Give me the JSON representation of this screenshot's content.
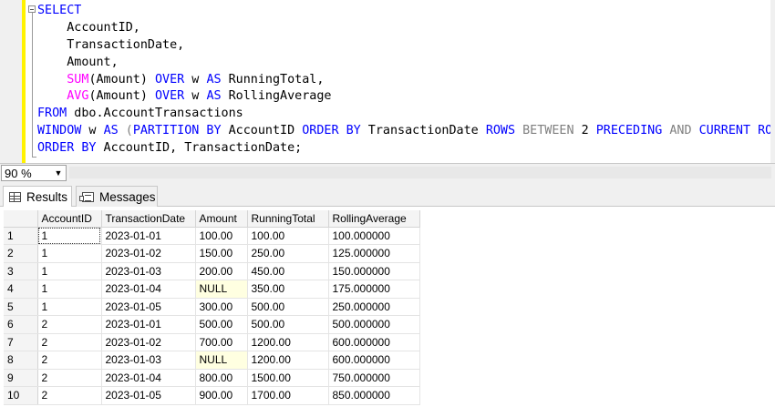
{
  "editor": {
    "code_lines": [
      [
        {
          "t": "SELECT",
          "c": "kw"
        }
      ],
      [
        {
          "t": "    AccountID,",
          "c": "id"
        }
      ],
      [
        {
          "t": "    TransactionDate,",
          "c": "id"
        }
      ],
      [
        {
          "t": "    Amount,",
          "c": "id"
        }
      ],
      [
        {
          "t": "    ",
          "c": "id"
        },
        {
          "t": "SUM",
          "c": "fn"
        },
        {
          "t": "(Amount) ",
          "c": "id"
        },
        {
          "t": "OVER",
          "c": "kw"
        },
        {
          "t": " w ",
          "c": "id"
        },
        {
          "t": "AS",
          "c": "kw"
        },
        {
          "t": " RunningTotal,",
          "c": "id"
        }
      ],
      [
        {
          "t": "    ",
          "c": "id"
        },
        {
          "t": "AVG",
          "c": "fn"
        },
        {
          "t": "(Amount) ",
          "c": "id"
        },
        {
          "t": "OVER",
          "c": "kw"
        },
        {
          "t": " w ",
          "c": "id"
        },
        {
          "t": "AS",
          "c": "kw"
        },
        {
          "t": " RollingAverage",
          "c": "id"
        }
      ],
      [
        {
          "t": "FROM",
          "c": "kw"
        },
        {
          "t": " dbo.AccountTransactions",
          "c": "id"
        }
      ],
      [
        {
          "t": "WINDOW",
          "c": "kw"
        },
        {
          "t": " w ",
          "c": "id"
        },
        {
          "t": "AS",
          "c": "kw"
        },
        {
          "t": " (",
          "c": "op"
        },
        {
          "t": "PARTITION BY",
          "c": "kw"
        },
        {
          "t": " AccountID ",
          "c": "id"
        },
        {
          "t": "ORDER BY",
          "c": "kw"
        },
        {
          "t": " TransactionDate ",
          "c": "id"
        },
        {
          "t": "ROWS",
          "c": "kw"
        },
        {
          "t": " BETWEEN ",
          "c": "op"
        },
        {
          "t": "2 ",
          "c": "id"
        },
        {
          "t": "PRECEDING",
          "c": "kw"
        },
        {
          "t": " AND ",
          "c": "op"
        },
        {
          "t": "CURRENT ROW",
          "c": "kw"
        },
        {
          "t": ")",
          "c": "op"
        }
      ],
      [
        {
          "t": "ORDER BY",
          "c": "kw"
        },
        {
          "t": " AccountID, TransactionDate;",
          "c": "id"
        }
      ]
    ]
  },
  "zoom": {
    "value": "90 %"
  },
  "tabs": {
    "results_label": "Results",
    "messages_label": "Messages"
  },
  "grid": {
    "columns": [
      "AccountID",
      "TransactionDate",
      "Amount",
      "RunningTotal",
      "RollingAverage"
    ],
    "rows": [
      {
        "n": "1",
        "cells": [
          "1",
          "2023-01-01",
          "100.00",
          "100.00",
          "100.000000"
        ]
      },
      {
        "n": "2",
        "cells": [
          "1",
          "2023-01-02",
          "150.00",
          "250.00",
          "125.000000"
        ]
      },
      {
        "n": "3",
        "cells": [
          "1",
          "2023-01-03",
          "200.00",
          "450.00",
          "150.000000"
        ]
      },
      {
        "n": "4",
        "cells": [
          "1",
          "2023-01-04",
          "NULL",
          "350.00",
          "175.000000"
        ]
      },
      {
        "n": "5",
        "cells": [
          "1",
          "2023-01-05",
          "300.00",
          "500.00",
          "250.000000"
        ]
      },
      {
        "n": "6",
        "cells": [
          "2",
          "2023-01-01",
          "500.00",
          "500.00",
          "500.000000"
        ]
      },
      {
        "n": "7",
        "cells": [
          "2",
          "2023-01-02",
          "700.00",
          "1200.00",
          "600.000000"
        ]
      },
      {
        "n": "8",
        "cells": [
          "2",
          "2023-01-03",
          "NULL",
          "1200.00",
          "600.000000"
        ]
      },
      {
        "n": "9",
        "cells": [
          "2",
          "2023-01-04",
          "800.00",
          "1500.00",
          "750.000000"
        ]
      },
      {
        "n": "10",
        "cells": [
          "2",
          "2023-01-05",
          "900.00",
          "1700.00",
          "850.000000"
        ]
      }
    ]
  },
  "colors": {
    "keyword": "#0000ff",
    "function": "#ff00ff",
    "operator": "#808080",
    "null_cell": "#ffffe1",
    "change_bar": "#fff200"
  }
}
